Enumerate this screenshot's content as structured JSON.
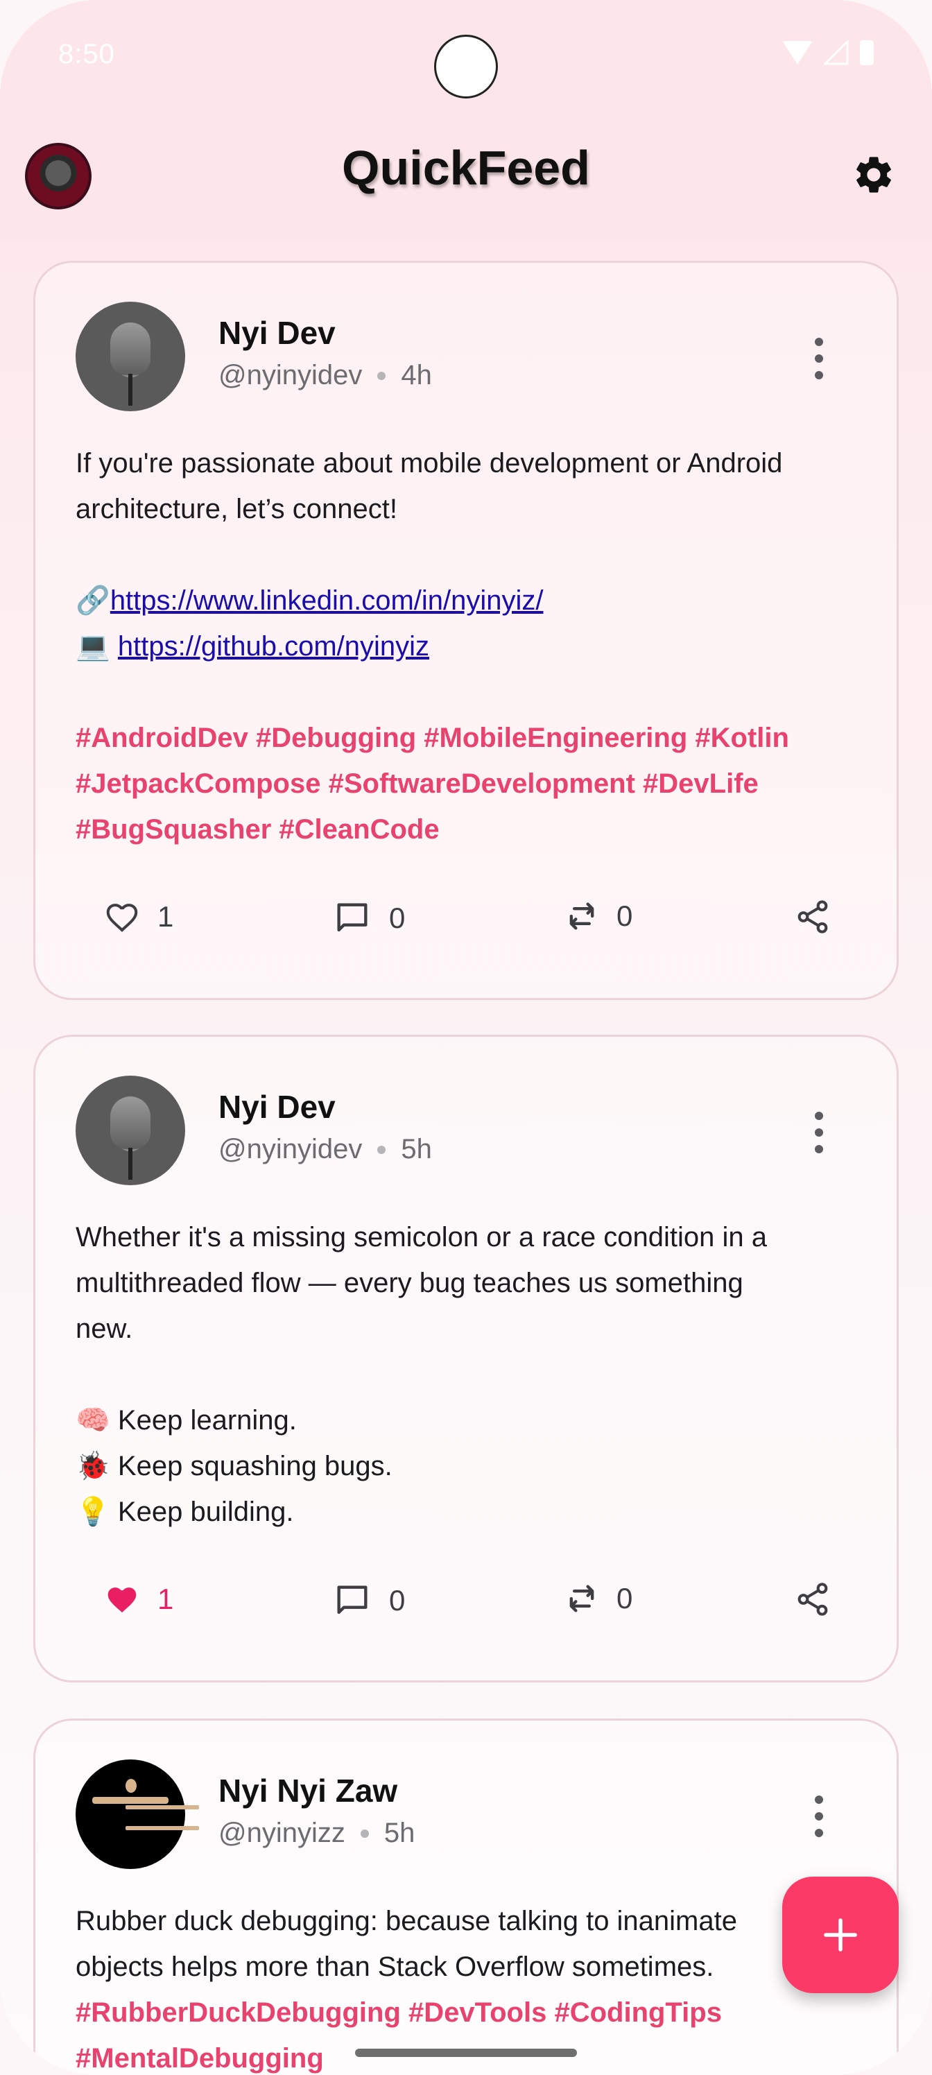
{
  "status_bar": {
    "time": "8:50"
  },
  "app_bar": {
    "title": "QuickFeed"
  },
  "posts": [
    {
      "author": "Nyi Dev",
      "handle": "@nyinyidev",
      "time": "4h",
      "lines": [
        "If you're passionate about mobile development or Android",
        "architecture, let’s connect!"
      ],
      "link1_prefix": "🔗",
      "link1": "https://www.linkedin.com/in/nyinyiz/",
      "link2_prefix": "💻 ",
      "link2": "https://github.com/nyinyiz",
      "tags": [
        "#AndroidDev #Debugging #MobileEngineering #Kotlin",
        "#JetpackCompose #SoftwareDevelopment #DevLife",
        "#BugSquasher #CleanCode"
      ],
      "likes": "1",
      "comments": "0",
      "reposts": "0",
      "liked": false
    },
    {
      "author": "Nyi Dev",
      "handle": "@nyinyidev",
      "time": "5h",
      "lines": [
        "Whether it's a missing semicolon or a race condition in a",
        "multithreaded flow — every bug teaches us something",
        "new.",
        "",
        "🧠 Keep learning.",
        "🐞 Keep squashing bugs.",
        "💡 Keep building."
      ],
      "likes": "1",
      "comments": "0",
      "reposts": "0",
      "liked": true
    },
    {
      "author": "Nyi Nyi Zaw",
      "handle": "@nyinyizz",
      "time": "5h",
      "lines": [
        "Rubber duck debugging: because talking to inanimate",
        "objects helps more than Stack Overflow sometimes."
      ],
      "tags": [
        "#RubberDuckDebugging #DevTools #CodingTips",
        "#MentalDebugging"
      ]
    }
  ],
  "icons": {
    "settings": "gear-icon",
    "more": "more-vert-icon",
    "like": "heart-icon",
    "comment": "comment-icon",
    "repost": "repost-icon",
    "share": "share-icon",
    "fab": "plus-icon"
  },
  "colors": {
    "accent": "#fb3a68",
    "hashtag": "#e8426f",
    "liked": "#e91e63",
    "app_bar": "#fde6ea"
  }
}
